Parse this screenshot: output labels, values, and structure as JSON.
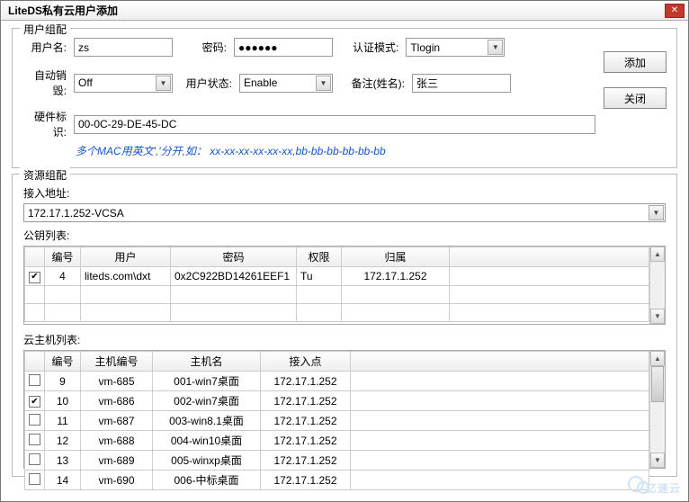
{
  "window": {
    "title": "LiteDS私有云用户添加"
  },
  "buttons": {
    "add": "添加",
    "close": "关闭"
  },
  "user_group": {
    "legend": "用户组配",
    "username_label": "用户名:",
    "username": "zs",
    "password_label": "密码:",
    "password": "●●●●●●",
    "auth_label": "认证模式:",
    "auth": "Tlogin",
    "autodestroy_label": "自动销毁:",
    "autodestroy": "Off",
    "status_label": "用户状态:",
    "status": "Enable",
    "remark_label": "备注(姓名):",
    "remark": "张三",
    "hwid_label": "硬件标识:",
    "hwid": "00-0C-29-DE-45-DC",
    "hint_prefix": "多个MAC用英文','分开,如：",
    "hint_example": "xx-xx-xx-xx-xx-xx,bb-bb-bb-bb-bb-bb"
  },
  "resource_group": {
    "legend": "资源组配",
    "access_label": "接入地址:",
    "access_value": "172.17.1.252-VCSA",
    "pubkey_label": "公钥列表:",
    "pubkey_headers": {
      "no": "编号",
      "user": "用户",
      "pwd": "密码",
      "auth": "权限",
      "belong": "归属"
    },
    "pubkeys": [
      {
        "checked": true,
        "no": "4",
        "user": "liteds.com\\dxt",
        "pwd": "0x2C922BD14261EEF1",
        "auth": "Tu",
        "belong": "172.17.1.252"
      }
    ],
    "host_label": "云主机列表:",
    "host_headers": {
      "no": "编号",
      "hostno": "主机编号",
      "hostname": "主机名",
      "access": "接入点"
    },
    "hosts": [
      {
        "checked": false,
        "no": "9",
        "hostno": "vm-685",
        "hostname": "001-win7桌面",
        "access": "172.17.1.252"
      },
      {
        "checked": true,
        "no": "10",
        "hostno": "vm-686",
        "hostname": "002-win7桌面",
        "access": "172.17.1.252"
      },
      {
        "checked": false,
        "no": "11",
        "hostno": "vm-687",
        "hostname": "003-win8.1桌面",
        "access": "172.17.1.252"
      },
      {
        "checked": false,
        "no": "12",
        "hostno": "vm-688",
        "hostname": "004-win10桌面",
        "access": "172.17.1.252"
      },
      {
        "checked": false,
        "no": "13",
        "hostno": "vm-689",
        "hostname": "005-winxp桌面",
        "access": "172.17.1.252"
      },
      {
        "checked": false,
        "no": "14",
        "hostno": "vm-690",
        "hostname": "006-中标桌面",
        "access": "172.17.1.252"
      }
    ]
  },
  "watermark": "亿速云"
}
